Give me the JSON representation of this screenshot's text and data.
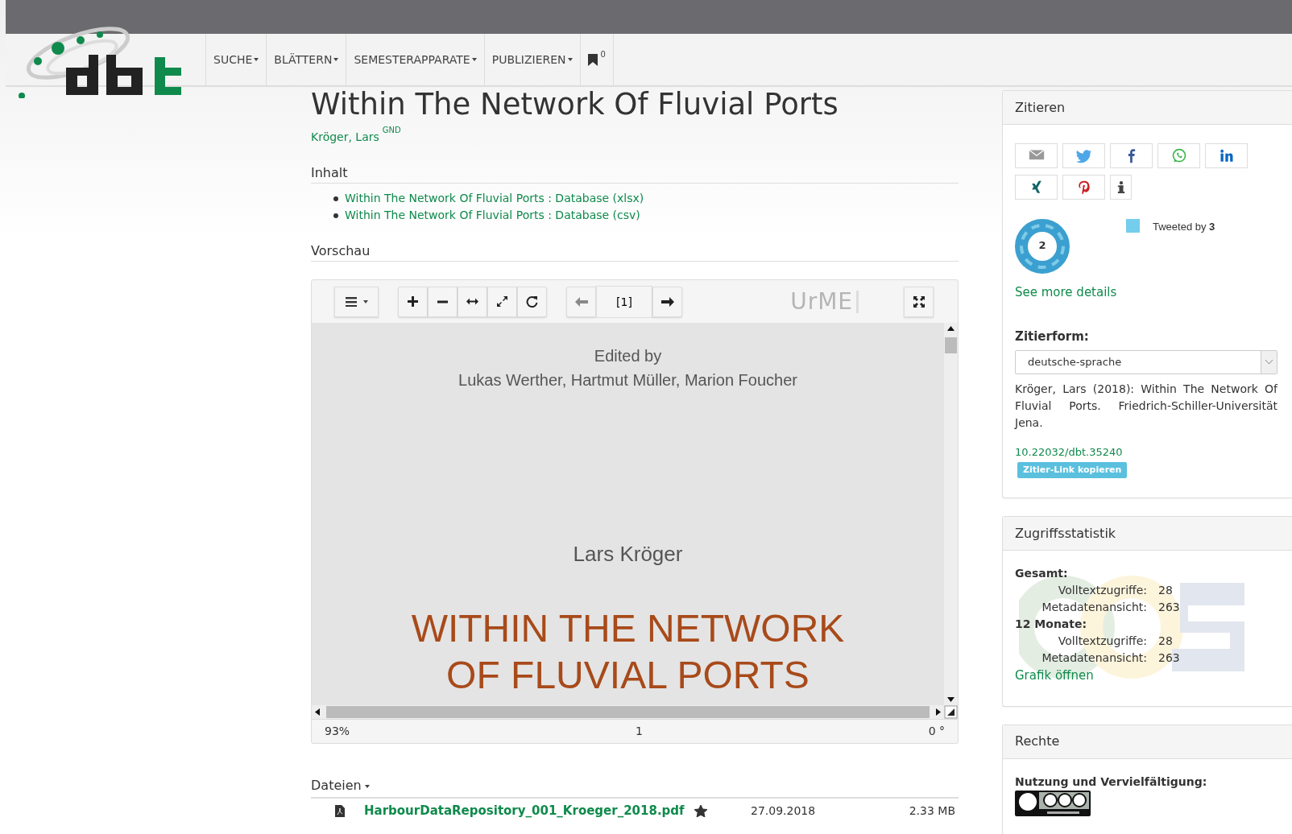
{
  "nav": {
    "items": [
      {
        "label": "SUCHE",
        "dropdown": true
      },
      {
        "label": "BLÄTTERN",
        "dropdown": true
      },
      {
        "label": "SEMESTERAPPARATE",
        "dropdown": true
      },
      {
        "label": "PUBLIZIEREN",
        "dropdown": true
      }
    ],
    "bookmark_count": "0"
  },
  "record": {
    "title": "Within The Network Of Fluvial Ports",
    "author": "Kröger, Lars",
    "author_badge": "GND"
  },
  "contents": {
    "heading": "Inhalt",
    "items": [
      "Within The Network Of Fluvial Ports : Database (xlsx)",
      "Within The Network Of Fluvial Ports : Database (csv)"
    ]
  },
  "preview": {
    "heading": "Vorschau",
    "page_field": "[1]",
    "viewer_logo": "UrME",
    "document": {
      "editors_label": "Edited by",
      "editors": "Lukas Werther, Hartmut Müller, Marion Foucher",
      "author": "Lars Kröger",
      "title_lines": [
        "WITHIN THE NETWORK",
        "OF FLUVIAL PORTS"
      ]
    },
    "status": {
      "zoom": "93%",
      "page": "1",
      "rotation": "0 °"
    }
  },
  "files": {
    "heading": "Dateien",
    "rows": [
      {
        "name": "HarbourDataRepository_001_Kroeger_2018.pdf",
        "starred": true,
        "date": "27.09.2018",
        "size": "2.33 MB"
      }
    ]
  },
  "cite": {
    "heading": "Zitieren",
    "altmetric_score": "2",
    "tweeted_label": "Tweeted by",
    "tweeted_count": "3",
    "details_link": "See more details",
    "form_label": "Zitierform:",
    "form_value": "deutsche-sprache",
    "citation": "Kröger, Lars (2018): Within The Network Of Fluvial Ports. Friedrich-Schiller-Universität Jena.",
    "doi": "10.22032/dbt.35240",
    "copy_button": "Zitier-Link kopieren"
  },
  "stats": {
    "heading": "Zugriffsstatistik",
    "groups": [
      {
        "label": "Gesamt:",
        "rows": [
          {
            "label": "Volltextzugriffe:",
            "value": "28"
          },
          {
            "label": "Metadatenansicht:",
            "value": "263"
          }
        ]
      },
      {
        "label": "12 Monate:",
        "rows": [
          {
            "label": "Volltextzugriffe:",
            "value": "28"
          },
          {
            "label": "Metadatenansicht:",
            "value": "263"
          }
        ]
      }
    ],
    "link": "Grafik öffnen"
  },
  "rights": {
    "heading": "Rechte",
    "label": "Nutzung und Vervielfältigung:"
  }
}
